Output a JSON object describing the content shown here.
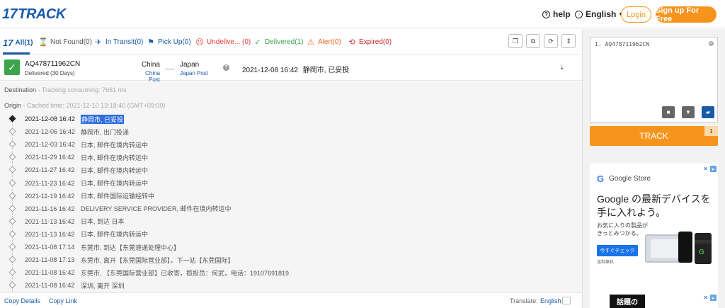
{
  "header": {
    "logo_num": "17",
    "logo_text": "TRACK",
    "help_label": "help",
    "language_label": "English",
    "login_label": "Login",
    "signup_label": "Sign up For Free"
  },
  "tabs": [
    {
      "label": "All(1)",
      "icon": "17-badge-icon",
      "color": "#1a5ba8"
    },
    {
      "label": "Not Found(0)",
      "icon": "hourglass-icon",
      "color": "#555555"
    },
    {
      "label": "In Transit(0)",
      "icon": "plane-icon",
      "color": "#1a5ba8"
    },
    {
      "label": "Pick Up(0)",
      "icon": "flag-icon",
      "color": "#1a5ba8"
    },
    {
      "label": "Undelive... (0)",
      "icon": "sad-face-icon",
      "color": "#e53935"
    },
    {
      "label": "Delivered(1)",
      "icon": "check-icon",
      "color": "#3aa54a"
    },
    {
      "label": "Alert(0)",
      "icon": "warning-icon",
      "color": "#f26522"
    },
    {
      "label": "Expired(0)",
      "icon": "clock-back-icon",
      "color": "#c62828"
    }
  ],
  "shipment": {
    "tracking_number": "AQ478711962CN",
    "status": "Delivered (30 Days)",
    "origin_country": "China",
    "origin_carrier": "China Post",
    "destination_country": "Japan",
    "destination_carrier": "Japan Post",
    "latest_time": "2021-12-08 16:42",
    "latest_event": "静岡市, 已妥投"
  },
  "destination_section": {
    "label": "Destination",
    "note": " - Tracking consuming: 7661 ms"
  },
  "origin_section": {
    "label": "Origin",
    "note": " - Cached time: 2021-12-10 13:18:40 (GMT+09:00)"
  },
  "events": [
    {
      "time": "2021-12-08 16:42",
      "desc": "静岡市, 已妥投"
    },
    {
      "time": "2021-12-06 16:42",
      "desc": "静岡市, 出门投递"
    },
    {
      "time": "2021-12-03 16:42",
      "desc": "日本, 邮件在境内转运中"
    },
    {
      "time": "2021-11-29 16:42",
      "desc": "日本, 邮件在境内转运中"
    },
    {
      "time": "2021-11-27 16:42",
      "desc": "日本, 邮件在境内转运中"
    },
    {
      "time": "2021-11-23 16:42",
      "desc": "日本, 邮件在境内转运中"
    },
    {
      "time": "2021-11-19 16:42",
      "desc": "日本, 邮件国际运输经转中"
    },
    {
      "time": "2021-11-16 16:42",
      "desc": "DELIVERY SERVICE PROVIDER, 邮件在境内转运中"
    },
    {
      "time": "2021-11-13 16:42",
      "desc": "日本, 到达 日本"
    },
    {
      "time": "2021-11-13 16:42",
      "desc": "日本, 邮件在境内转运中"
    },
    {
      "time": "2021-11-08 17:14",
      "desc": "东莞市, 到达【东莞速递处理中心】"
    },
    {
      "time": "2021-11-08 17:13",
      "desc": "东莞市, 离开【东莞国际营业部】，下一站【东莞国际】"
    },
    {
      "time": "2021-11-08 16:42",
      "desc": "东莞市, 【东莞国际营业部】已收寄，揽投员：何武，电话：19107691819"
    },
    {
      "time": "2021-11-08 16:42",
      "desc": "深圳, 离开 深圳"
    }
  ],
  "footer": {
    "copy_details": "Copy Details",
    "copy_link": "Copy Link",
    "translate_label": "Translate:",
    "translate_lang": "English"
  },
  "sidebar": {
    "textarea_value": "1. AQ478711962CN",
    "track_label": "TRACK",
    "track_count": "1"
  },
  "ad": {
    "brand": "Google Store",
    "headline": "Google の最新デバイスを手に入れよう。",
    "sub_line1": "お気に入りの製品が",
    "sub_line2": "きっとみつかる。",
    "cta": "今すぐチェック",
    "small": "送料無料"
  },
  "ad2": {
    "text": "話題の"
  },
  "colors": {
    "brand_blue": "#1a5ba8",
    "accent_orange": "#f7941d",
    "delivered_green": "#3aa54a"
  }
}
